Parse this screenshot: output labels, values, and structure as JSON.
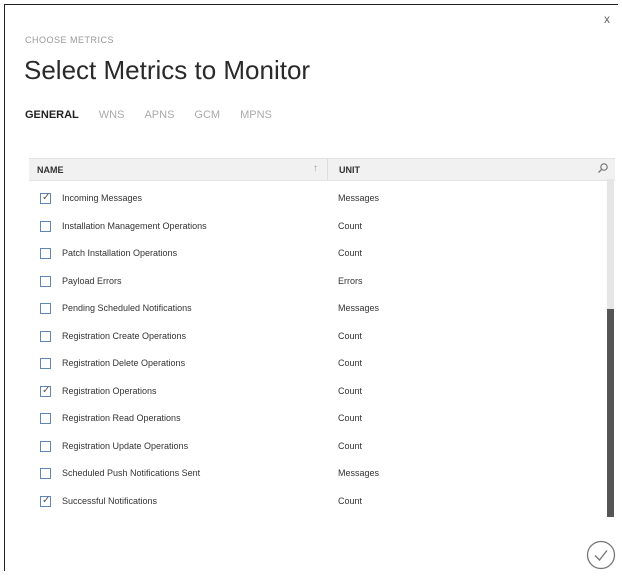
{
  "dialog": {
    "close_glyph": "x",
    "subtitle": "CHOOSE METRICS",
    "title": "Select Metrics to Monitor"
  },
  "tabs": [
    {
      "label": "GENERAL",
      "active": true
    },
    {
      "label": "WNS",
      "active": false
    },
    {
      "label": "APNS",
      "active": false
    },
    {
      "label": "GCM",
      "active": false
    },
    {
      "label": "MPNS",
      "active": false
    }
  ],
  "grid": {
    "col_name": "NAME",
    "col_unit": "UNIT",
    "sort_icon": "sort-icon",
    "search_icon": "search-icon",
    "rows": [
      {
        "name": "Incoming Messages",
        "unit": "Messages",
        "checked": true
      },
      {
        "name": "Installation Management Operations",
        "unit": "Count",
        "checked": false
      },
      {
        "name": "Patch Installation Operations",
        "unit": "Count",
        "checked": false
      },
      {
        "name": "Payload Errors",
        "unit": "Errors",
        "checked": false
      },
      {
        "name": "Pending Scheduled Notifications",
        "unit": "Messages",
        "checked": false
      },
      {
        "name": "Registration Create Operations",
        "unit": "Count",
        "checked": false
      },
      {
        "name": "Registration Delete Operations",
        "unit": "Count",
        "checked": false
      },
      {
        "name": "Registration Operations",
        "unit": "Count",
        "checked": true
      },
      {
        "name": "Registration Read Operations",
        "unit": "Count",
        "checked": false
      },
      {
        "name": "Registration Update Operations",
        "unit": "Count",
        "checked": false
      },
      {
        "name": "Scheduled Push Notifications Sent",
        "unit": "Messages",
        "checked": false
      },
      {
        "name": "Successful Notifications",
        "unit": "Count",
        "checked": true
      }
    ]
  },
  "colors": {
    "checkbox_border": "#5f87b5",
    "header_bg": "#f1f1f1",
    "scroll_thumb": "#555555"
  }
}
